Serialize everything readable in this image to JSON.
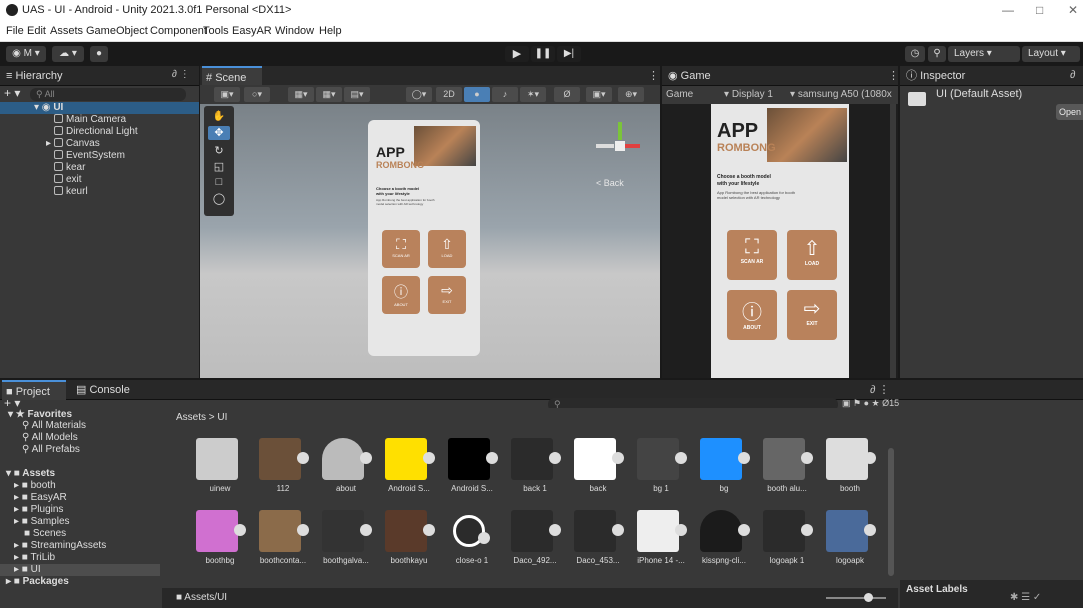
{
  "window": {
    "title": "UAS - UI - Android - Unity 2021.3.0f1 Personal <DX11>"
  },
  "menu": [
    "File",
    "Edit",
    "Assets",
    "GameObject",
    "Component",
    "Tools",
    "EasyAR",
    "Window",
    "Help"
  ],
  "toolbar": {
    "account": "M",
    "layers": "Layers",
    "layout": "Layout"
  },
  "hierarchy": {
    "tab": "Hierarchy",
    "search_placeholder": "All",
    "root": "UI",
    "items": [
      "Main Camera",
      "Directional Light",
      "Canvas",
      "EventSystem",
      "kear",
      "exit",
      "keurl"
    ]
  },
  "scene": {
    "tab": "Scene",
    "mode_2d": "2D",
    "back_label": "< Back"
  },
  "game": {
    "tab": "Game",
    "mode": "Game",
    "display": "Display 1",
    "device": "samsung A50 (1080x"
  },
  "inspector": {
    "tab": "Inspector",
    "asset": "UI (Default Asset)",
    "open": "Open",
    "labels": "Asset Labels"
  },
  "app": {
    "title": "APP",
    "subtitle": "ROMBONG",
    "heading_line1": "Choose a booth model",
    "heading_line2": "with your lifestyle",
    "desc_game": "App Rombong the best application for booth model selection with AR technology",
    "buttons": [
      "SCAN AR",
      "LOAD",
      "ABOUT",
      "EXIT"
    ],
    "scene_buttons": [
      "SCAN AR",
      "LOAD",
      "ABOUT",
      "EXIT"
    ]
  },
  "project": {
    "tab_project": "Project",
    "tab_console": "Console",
    "favorites": "Favorites",
    "fav_items": [
      "All Materials",
      "All Models",
      "All Prefabs"
    ],
    "assets_root": "Assets",
    "asset_folders": [
      "booth",
      "EasyAR",
      "Plugins",
      "Samples",
      "Scenes",
      "StreamingAssets",
      "TriLib",
      "UI"
    ],
    "packages": "Packages",
    "breadcrumb": "Assets > UI",
    "path": "Assets/UI",
    "hidden_count": "15",
    "row1": [
      "uinew",
      "112",
      "about",
      "Android S...",
      "Android S...",
      "back 1",
      "back",
      "bg 1",
      "bg",
      "booth alu...",
      "booth"
    ],
    "row2": [
      "boothbg",
      "boothconta...",
      "boothgalva...",
      "boothkayu",
      "close-o 1",
      "Daco_492...",
      "Daco_453...",
      "iPhone 14 -...",
      "kisspng-cli...",
      "logoapk 1",
      "logoapk"
    ]
  }
}
